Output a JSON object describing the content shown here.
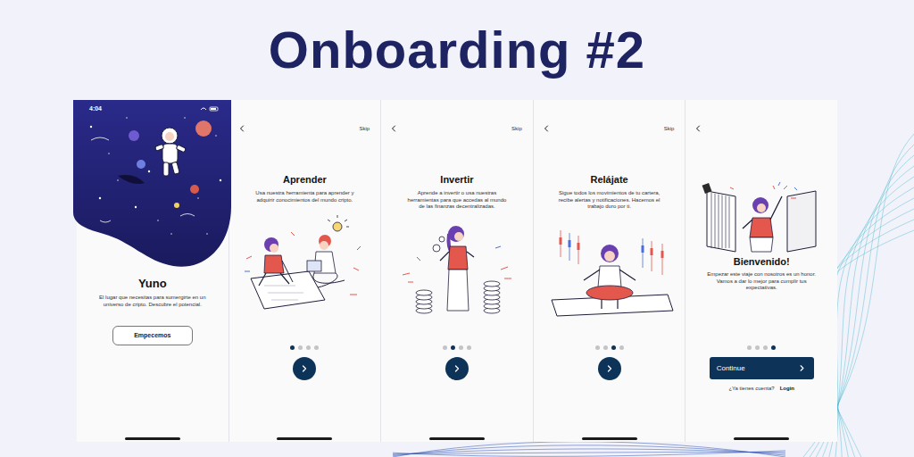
{
  "heading": "Onboarding #2",
  "screens": [
    {
      "kind": "splash",
      "time": "4:04",
      "title": "Yuno",
      "description": "El lugar que necesitas para sumergirte en un universo de cripto. Descubre el potencial.",
      "button": "Empecemos"
    },
    {
      "kind": "step",
      "skip": "Skip",
      "title": "Aprender",
      "description": "Usa nuestra herramienta para aprender y adquirir conocimientos del mundo cripto.",
      "dots": [
        {
          "selected": true
        },
        {
          "selected": false
        },
        {
          "selected": false
        },
        {
          "selected": false
        }
      ]
    },
    {
      "kind": "step",
      "skip": "Skip",
      "title": "Invertir",
      "description": "Aprende a invertir o usa nuestras herramientas para que accedas al mundo de las finanzas decentralizadas.",
      "dots": [
        {
          "selected": false
        },
        {
          "selected": true
        },
        {
          "selected": false
        },
        {
          "selected": false
        }
      ]
    },
    {
      "kind": "step",
      "skip": "Skip",
      "title": "Relájate",
      "description": "Sigue todos los movimientos de tu cartera, recibe alertas y notificaciones. Hacemos el trabajo duro por ti.",
      "dots": [
        {
          "selected": false
        },
        {
          "selected": false
        },
        {
          "selected": true
        },
        {
          "selected": false
        }
      ]
    },
    {
      "kind": "welcome",
      "title": "Bienvenido!",
      "description": "Empezar este viaje con nosotros es un honor. Vamos a dar lo mejor para cumplir tus expectativas.",
      "dots": [
        {
          "selected": false
        },
        {
          "selected": false
        },
        {
          "selected": false
        },
        {
          "selected": true
        }
      ],
      "button": "Continue",
      "account_prompt": "¿Ya tienes cuenta?",
      "login": "Login"
    }
  ]
}
